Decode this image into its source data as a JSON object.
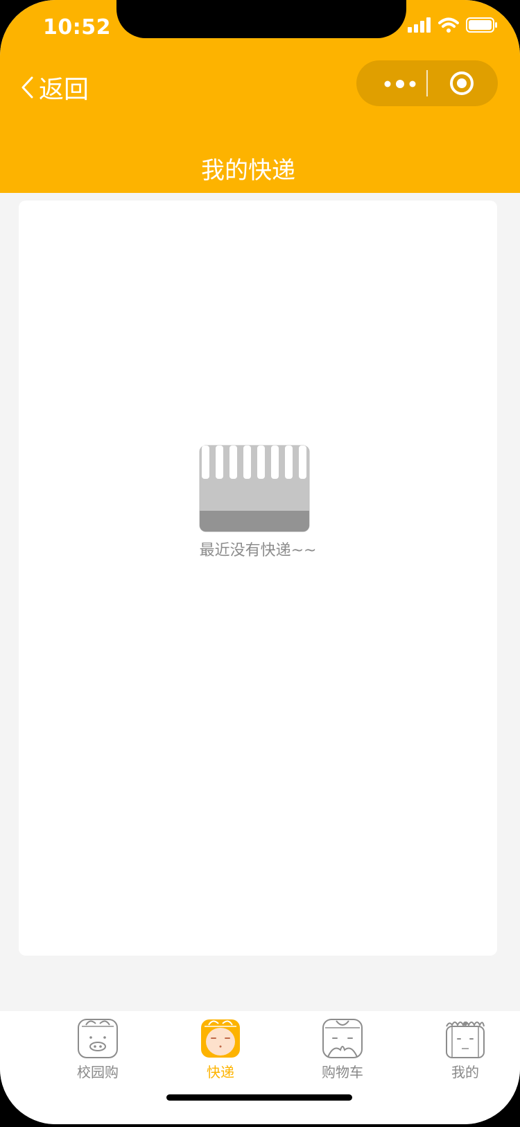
{
  "status_bar": {
    "time": "10:52"
  },
  "nav": {
    "back_label": "返回",
    "title": "我的快递"
  },
  "colors": {
    "accent": "#fdb300",
    "capsule": "#e09f00",
    "muted_text": "#8c8c8c"
  },
  "empty_state": {
    "message": "最近没有快递~~",
    "icon": "empty-box-icon"
  },
  "tabbar": {
    "items": [
      {
        "label": "校园购",
        "icon": "pig-face-icon",
        "active": false
      },
      {
        "label": "快递",
        "icon": "monkey-face-icon",
        "active": true
      },
      {
        "label": "购物车",
        "icon": "monk-face-icon",
        "active": false
      },
      {
        "label": "我的",
        "icon": "sand-monk-face-icon",
        "active": false
      }
    ]
  }
}
